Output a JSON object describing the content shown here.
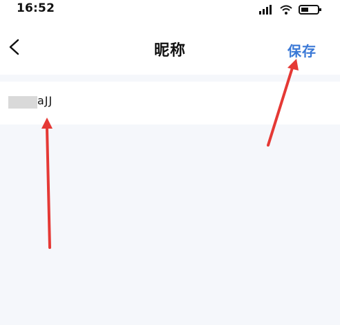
{
  "status_bar": {
    "time": "16:52",
    "icons": [
      "cellular-signal-icon",
      "wifi-icon",
      "battery-icon"
    ]
  },
  "header": {
    "back_icon": "chevron-left-icon",
    "title": "昵称",
    "save_label": "保存"
  },
  "field": {
    "value": "aJJ"
  },
  "colors": {
    "accent": "#3a78d6",
    "annotation_arrow": "#e53935",
    "background": "#f5f7fb"
  }
}
